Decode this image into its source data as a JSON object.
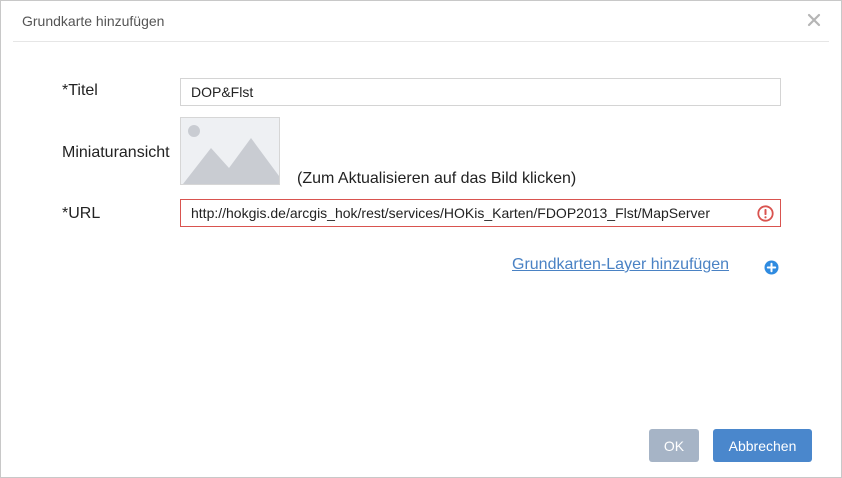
{
  "dialog": {
    "title": "Grundkarte hinzufügen",
    "close_icon": "close-icon"
  },
  "form": {
    "title_label": "*Titel",
    "title_value": "DOP&Flst",
    "thumbnail_label": "Miniaturansicht",
    "thumbnail_icon": "image-placeholder-icon",
    "thumbnail_hint": "(Zum Aktualisieren auf das Bild klicken)",
    "url_label": "*URL",
    "url_value": "http://hokgis.de/arcgis_hok/rest/services/HOKis_Karten/FDOP2013_Flst/MapServer",
    "url_error_icon": "error-icon",
    "add_layer_link": "Grundkarten-Layer hinzufügen",
    "add_layer_icon": "plus-circle-icon"
  },
  "footer": {
    "ok_label": "OK",
    "cancel_label": "Abbrechen"
  },
  "colors": {
    "link": "#4a82c4",
    "primary_button": "#4a87cc",
    "disabled_button": "#a6b4c6",
    "error": "#d9534f"
  }
}
